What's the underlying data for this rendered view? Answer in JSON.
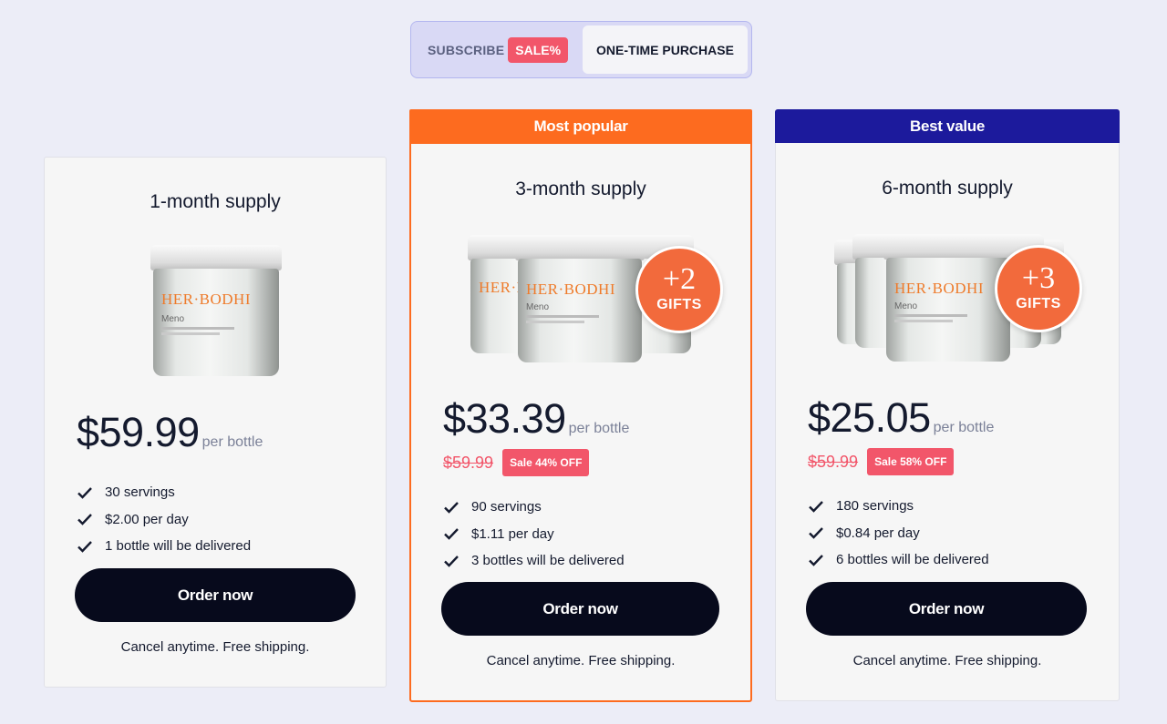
{
  "toggle": {
    "subscribe_label": "SUBSCRIBE",
    "sale_label": "SALE%",
    "one_time_label": "ONE-TIME PURCHASE"
  },
  "plans": [
    {
      "ribbon": "",
      "title": "1-month supply",
      "price": "$59.99",
      "per": "per bottle",
      "old_price": "",
      "sale_badge": "",
      "gifts": "",
      "features": [
        "30 servings",
        "$2.00 per day",
        "1 bottle will be delivered"
      ],
      "cta": "Order now",
      "footnote": "Cancel anytime. Free shipping."
    },
    {
      "ribbon": "Most popular",
      "title": "3-month supply",
      "price": "$33.39",
      "per": "per bottle",
      "old_price": "$59.99",
      "sale_badge": "Sale 44% OFF",
      "gifts": "+2",
      "gifts_word": "GIFTS",
      "features": [
        "90 servings",
        "$1.11 per day",
        "3 bottles will be delivered"
      ],
      "cta": "Order now",
      "footnote": "Cancel anytime. Free shipping."
    },
    {
      "ribbon": "Best value",
      "title": "6-month supply",
      "price": "$25.05",
      "per": "per bottle",
      "old_price": "$59.99",
      "sale_badge": "Sale 58% OFF",
      "gifts": "+3",
      "gifts_word": "GIFTS",
      "features": [
        "180 servings",
        "$0.84 per day",
        "6 bottles will be delivered"
      ],
      "cta": "Order now",
      "footnote": "Cancel anytime. Free shipping."
    }
  ],
  "product": {
    "brand": "HER·BODHI",
    "name": "Meno"
  },
  "colors": {
    "accent_orange": "#fd6b1f",
    "accent_navy": "#1c1a9c",
    "sale_red": "#f2566a",
    "button_dark": "#070a1c"
  },
  "icons": {
    "feature": "check-icon"
  }
}
